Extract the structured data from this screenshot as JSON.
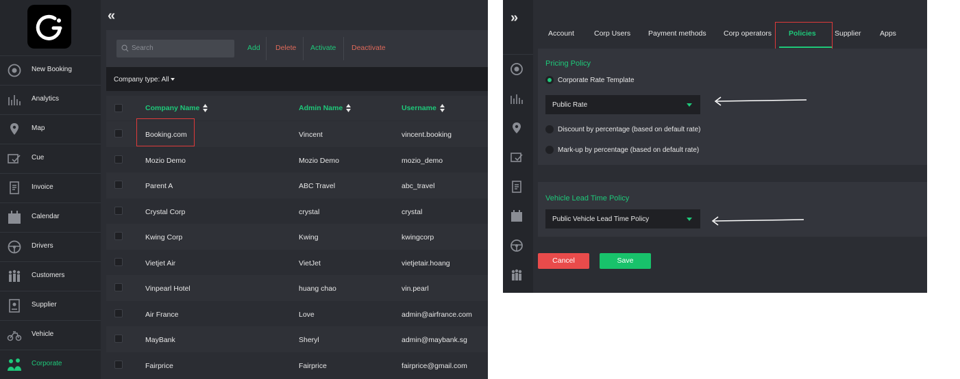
{
  "colors": {
    "accent": "#1ec97a",
    "danger": "#e94b4b",
    "highlight": "#e03a3a"
  },
  "sidebar": {
    "items": [
      {
        "label": "New Booking",
        "icon": "plus-circle-icon"
      },
      {
        "label": "Analytics",
        "icon": "chart-icon"
      },
      {
        "label": "Map",
        "icon": "map-pin-icon"
      },
      {
        "label": "Cue",
        "icon": "checklist-icon"
      },
      {
        "label": "Invoice",
        "icon": "invoice-icon"
      },
      {
        "label": "Calendar",
        "icon": "calendar-icon"
      },
      {
        "label": "Drivers",
        "icon": "steering-wheel-icon"
      },
      {
        "label": "Customers",
        "icon": "people-icon"
      },
      {
        "label": "Supplier",
        "icon": "supplier-icon"
      },
      {
        "label": "Vehicle",
        "icon": "vehicle-icon"
      },
      {
        "label": "Corporate",
        "icon": "corporate-icon",
        "active": true
      }
    ]
  },
  "toolbar": {
    "search_placeholder": "Search",
    "add": "Add",
    "delete": "Delete",
    "activate": "Activate",
    "deactivate": "Deactivate"
  },
  "filter": {
    "label": "Company type: All"
  },
  "table": {
    "columns": [
      "Company Name",
      "Admin Name",
      "Username"
    ],
    "rows": [
      [
        "Booking.com",
        "Vincent",
        "vincent.booking"
      ],
      [
        "Mozio Demo",
        "Mozio Demo",
        "mozio_demo"
      ],
      [
        "Parent A",
        "ABC Travel",
        "abc_travel"
      ],
      [
        "Crystal Corp",
        "crystal",
        "crystal"
      ],
      [
        "Kwing Corp",
        "Kwing",
        "kwingcorp"
      ],
      [
        "Vietjet Air",
        "VietJet",
        "vietjetair.hoang"
      ],
      [
        "Vinpearl Hotel",
        "huang chao",
        "vin.pearl"
      ],
      [
        "Air France",
        "Love",
        "admin@airfrance.com"
      ],
      [
        "MayBank",
        "Sheryl",
        "admin@maybank.sg"
      ],
      [
        "Fairprice",
        "Fairprice",
        "fairprice@gmail.com"
      ]
    ]
  },
  "detail": {
    "tabs": [
      "Account",
      "Corp Users",
      "Payment methods",
      "Corp operators",
      "Policies",
      "Supplier",
      "Apps"
    ],
    "active_tab": "Policies",
    "pricing": {
      "title": "Pricing Policy",
      "option_template": "Corporate Rate Template",
      "select_value": "Public Rate",
      "option_discount": "Discount by percentage (based on default rate)",
      "option_markup": "Mark-up by percentage (based on default rate)"
    },
    "lead_time": {
      "title": "Vehicle Lead Time Policy",
      "select_value": "Public Vehicle Lead Time Policy"
    },
    "cancel": "Cancel",
    "save": "Save"
  }
}
